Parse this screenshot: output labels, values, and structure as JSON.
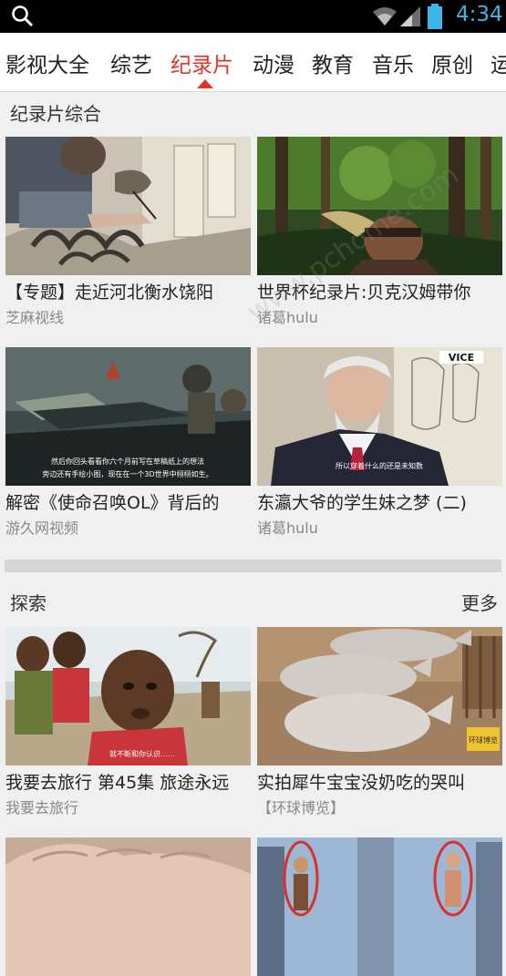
{
  "status_bar": {
    "time": "4:34",
    "icons": [
      "search-icon",
      "wifi-icon",
      "signal-icon",
      "battery-icon"
    ]
  },
  "nav": {
    "tabs": [
      "影视大全",
      "综艺",
      "纪录片",
      "动漫",
      "教育",
      "音乐",
      "原创",
      "运"
    ],
    "active_tab": "纪录片"
  },
  "sections": [
    {
      "title": "纪录片综合",
      "more": "",
      "cards": [
        {
          "title": "【专题】走近河北衡水饶阳",
          "source": "芝麻视线"
        },
        {
          "title": "世界杯纪录片:贝克汉姆带你",
          "source": "诸葛hulu"
        },
        {
          "title": "解密《使命召唤OL》背后的",
          "source": "游久网视频"
        },
        {
          "title": "东瀛大爷的学生妹之梦 (二)",
          "source": "诸葛hulu"
        }
      ]
    },
    {
      "title": "探索",
      "more": "更多",
      "cards": [
        {
          "title": "我要去旅行 第45集 旅途永远",
          "source": "我要去旅行"
        },
        {
          "title": "实拍犀牛宝宝没奶吃的哭叫",
          "source": "【环球博览】"
        },
        {
          "title": "",
          "source": ""
        },
        {
          "title": "",
          "source": ""
        }
      ]
    }
  ],
  "thumb_captions": {
    "game_caption_line1": "然后你回头看看你六个月前写在草稿纸上的想法",
    "game_caption_line2": "旁边还有手绘小图，现在在一个3D世界中栩栩如生。",
    "japan_caption": "所以穿着什么的还是未知数",
    "travel_caption": "就不断和你认识……",
    "vice_logo": "VICE",
    "huanqiu_logo": "环球博览"
  },
  "watermark": "www.pchome.com"
}
